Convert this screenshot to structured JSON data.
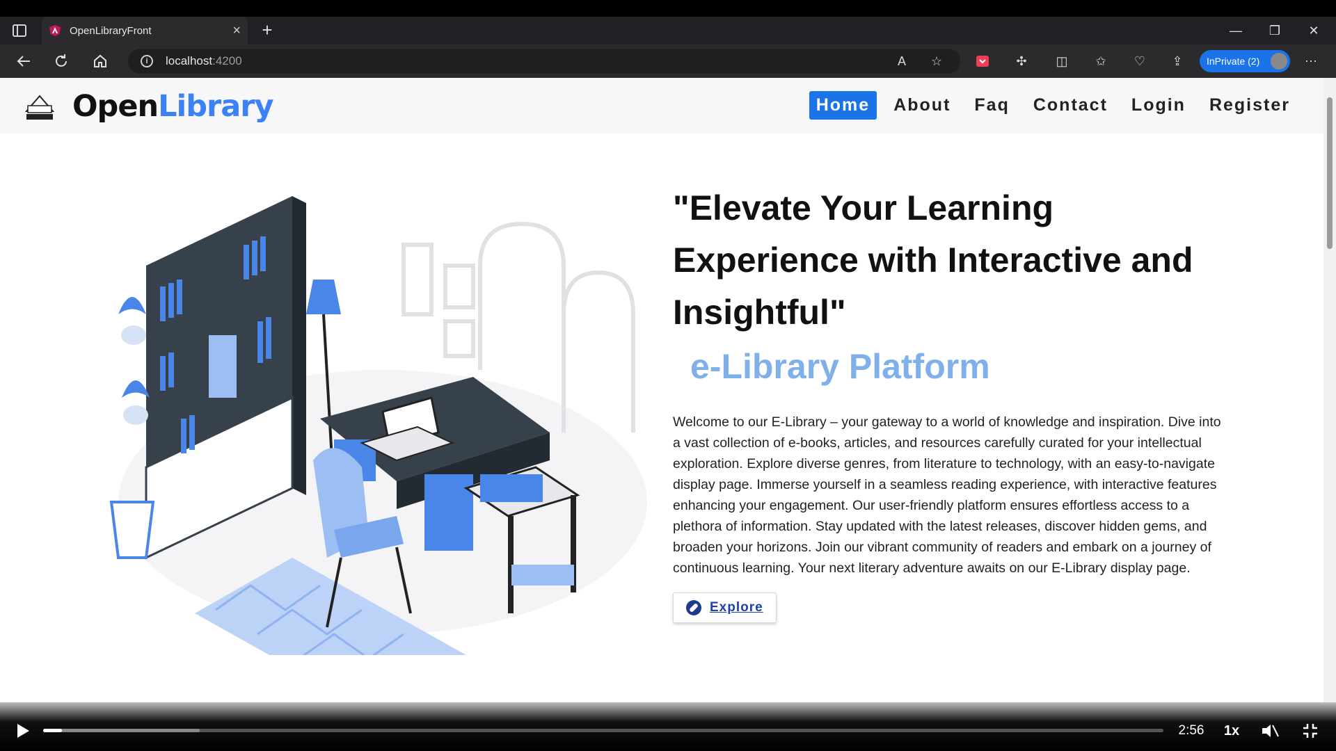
{
  "browser": {
    "tab_title": "OpenLibraryFront",
    "url_host": "localhost",
    "url_port": ":4200",
    "inprivate_label": "InPrivate (2)",
    "new_tab_symbol": "+",
    "close_tab_symbol": "×",
    "window_controls": [
      "—",
      "❐",
      "✕"
    ]
  },
  "navbar": {
    "brand_part1": "Open",
    "brand_part2": "Library",
    "links": [
      "Home",
      "About",
      "Faq",
      "Contact",
      "Login",
      "Register"
    ],
    "active_link": "Home"
  },
  "hero": {
    "headline": "\"Elevate Your Learning Experience with Interactive and Insightful\"",
    "subheadline": "e-Library Platform",
    "description": "Welcome to our E-Library – your gateway to a world of knowledge and inspiration. Dive into a vast collection of e-books, articles, and resources carefully curated for your intellectual exploration. Explore diverse genres, from literature to technology, with an easy-to-navigate display page. Immerse yourself in a seamless reading experience, with interactive features enhancing your engagement. Our user-friendly platform ensures effortless access to a plethora of information. Stay updated with the latest releases, discover hidden gems, and broaden your horizons. Join our vibrant community of readers and embark on a journey of continuous learning. Your next literary adventure awaits on our E-Library display page.",
    "button_label": "Explore"
  },
  "video": {
    "time": "2:56",
    "speed": "1x",
    "progress_fraction": 0.017,
    "buffered_fraction": 0.14
  },
  "colors": {
    "brand_blue": "#3b82f6",
    "active_nav": "#1a73e8",
    "subheadline": "#7fb0ea"
  }
}
